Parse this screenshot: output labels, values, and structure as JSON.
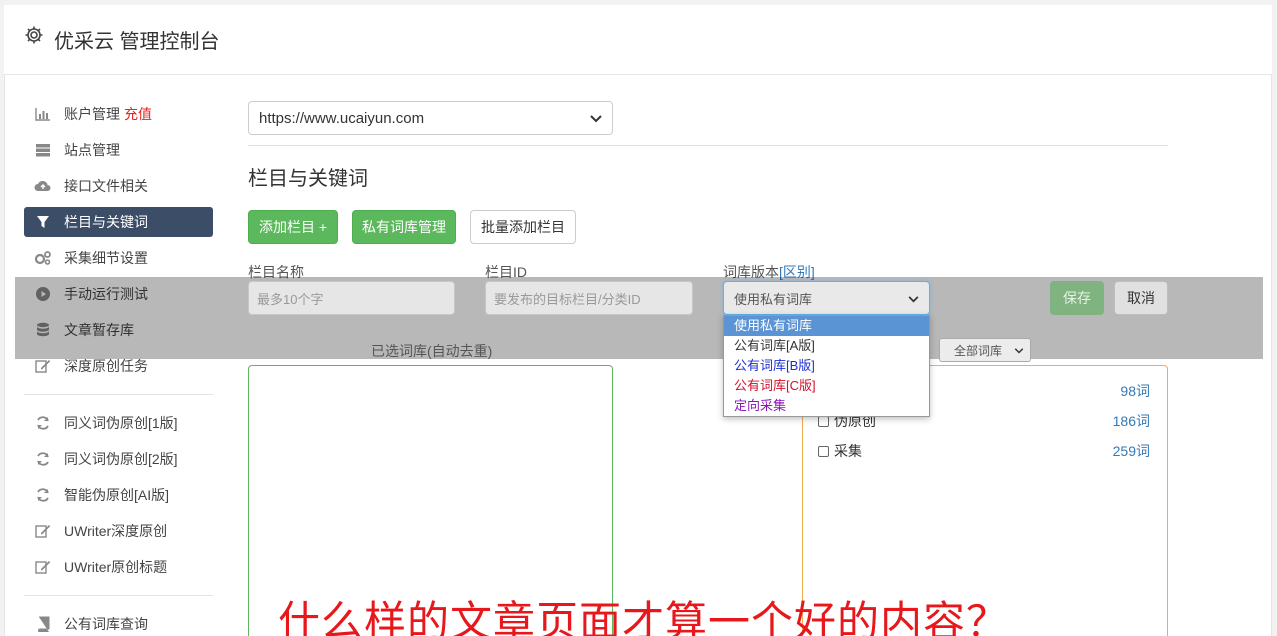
{
  "app": {
    "title": "优采云 管理控制台"
  },
  "sidebar": {
    "items": [
      {
        "label": "账户管理",
        "extra": "充值",
        "icon": "bar-chart-icon"
      },
      {
        "label": "站点管理",
        "icon": "server-icon"
      },
      {
        "label": "接口文件相关",
        "icon": "cloud-upload-icon"
      },
      {
        "label": "栏目与关键词",
        "icon": "filter-icon",
        "active": true
      },
      {
        "label": "采集细节设置",
        "icon": "gears-icon"
      },
      {
        "label": "手动运行测试",
        "icon": "play-circle-icon"
      },
      {
        "label": "文章暂存库",
        "icon": "database-icon"
      },
      {
        "label": "深度原创任务",
        "icon": "edit-icon"
      },
      {
        "label": "同义词伪原创[1版]",
        "icon": "refresh-icon"
      },
      {
        "label": "同义词伪原创[2版]",
        "icon": "refresh-icon"
      },
      {
        "label": "智能伪原创[AI版]",
        "icon": "refresh-icon"
      },
      {
        "label": "UWriter深度原创",
        "icon": "edit-icon"
      },
      {
        "label": "UWriter原创标题",
        "icon": "edit-icon"
      },
      {
        "label": "公有词库查询",
        "icon": "book-icon"
      }
    ]
  },
  "main": {
    "site_select": "https://www.ucaiyun.com",
    "section_title": "栏目与关键词",
    "buttons": {
      "add_column": "添加栏目 +",
      "private_lib": "私有词库管理",
      "batch_add": "批量添加栏目"
    },
    "form": {
      "name_label": "栏目名称",
      "name_placeholder": "最多10个字",
      "id_label": "栏目ID",
      "id_placeholder": "要发布的目标栏目/分类ID",
      "version_label": "词库版本",
      "version_link": "[区别]",
      "version_value": "使用私有词库",
      "save": "保存",
      "cancel": "取消"
    },
    "dropdown_options": [
      {
        "label": "使用私有词库",
        "color": "#ffffff",
        "selected": true
      },
      {
        "label": "公有词库[A版]",
        "color": "#333333"
      },
      {
        "label": "公有词库[B版]",
        "color": "#1f2fd1"
      },
      {
        "label": "公有词库[C版]",
        "color": "#d0122b"
      },
      {
        "label": "定向采集",
        "color": "#8a17b8"
      }
    ],
    "selected_lib_label": "已选词库(自动去重)",
    "all_lib": "全部词库",
    "libraries": [
      {
        "name": "",
        "count": "98词"
      },
      {
        "name": "伪原创",
        "count": "186词"
      },
      {
        "name": "采集",
        "count": "259词"
      }
    ]
  },
  "caption": "什么样的文章页面才算一个好的内容？"
}
